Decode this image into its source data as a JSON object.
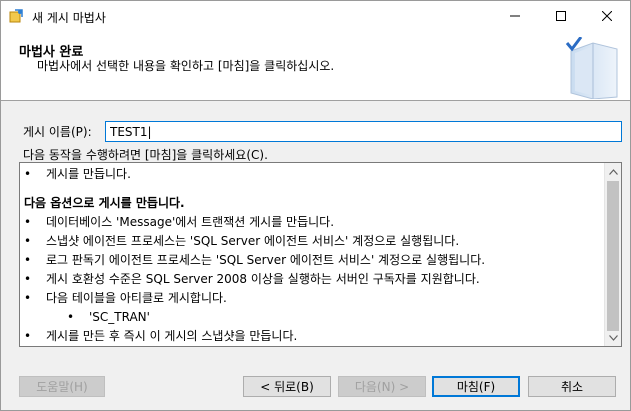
{
  "window": {
    "title": "새 게시 마법사"
  },
  "header": {
    "title": "마법사 완료",
    "description": "마법사에서 선택한 내용을 확인하고 [마침]을 클릭하십시오."
  },
  "publication": {
    "label": "게시 이름(P):",
    "value": "TEST1|"
  },
  "instruction": "다음 동작을 수행하려면 [마침]을 클릭하세요(C).",
  "summary": {
    "line1": "게시를 만듭니다.",
    "options_heading": "다음 옵션으로 게시를 만듭니다.",
    "opt1": "데이터베이스 'Message'에서 트랜잭션 게시를 만듭니다.",
    "opt2": "스냅샷 에이전트 프로세스는 'SQL Server 에이전트 서비스' 계정으로 실행됩니다.",
    "opt3": "로그 판독기 에이전트 프로세스는 'SQL Server 에이전트 서비스' 계정으로 실행됩니다.",
    "opt4": "게시 호환성 수준은 SQL Server 2008 이상을 실행하는 서버인 구독자를 지원합니다.",
    "opt5": "다음 테이블을 아티클로 게시합니다.",
    "article": "'SC_TRAN'",
    "opt6": "게시를 만든 후 즉시 이 게시의 스냅샷을 만듭니다.",
    "bullet_char": "•"
  },
  "buttons": {
    "help": "도움말(H)",
    "back": "< 뒤로(B)",
    "next": "다음(N) >",
    "finish": "마침(F)",
    "cancel": "취소"
  }
}
